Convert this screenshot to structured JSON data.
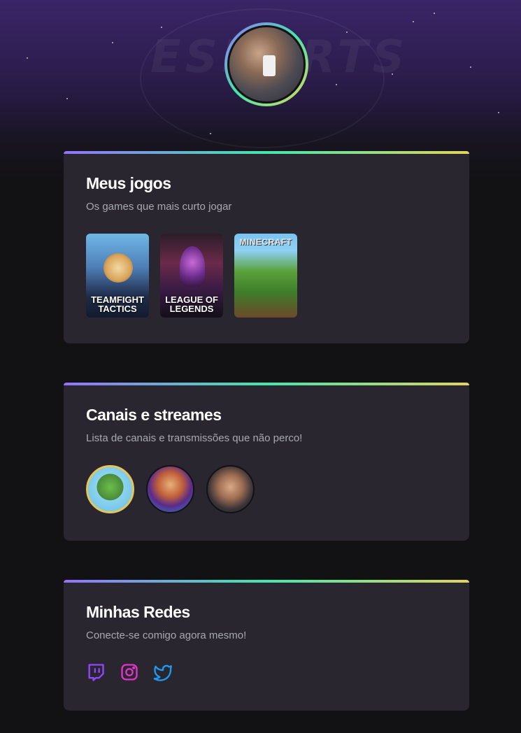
{
  "profile": {
    "avatar_alt": "Foto de perfil"
  },
  "cards": {
    "games": {
      "title": "Meus jogos",
      "subtitle": "Os games que mais curto jogar",
      "items": [
        {
          "label": "TEAMFIGHT TACTICS"
        },
        {
          "label": "LEAGUE OF LEGENDS"
        },
        {
          "label": "MINECRAFT"
        }
      ]
    },
    "channels": {
      "title": "Canais e streames",
      "subtitle": "Lista de canais e transmissões que não perco!"
    },
    "socials": {
      "title": "Minhas Redes",
      "subtitle": "Conecte-se comigo agora mesmo!",
      "icons": [
        "twitch-icon",
        "instagram-icon",
        "twitter-icon"
      ]
    }
  },
  "colors": {
    "gradient_start": "#9572fc",
    "gradient_mid": "#43e7ad",
    "gradient_end": "#e2d45c",
    "twitch": "#9146ff",
    "instagram": "#e135c8",
    "twitter": "#1d9bf0"
  }
}
